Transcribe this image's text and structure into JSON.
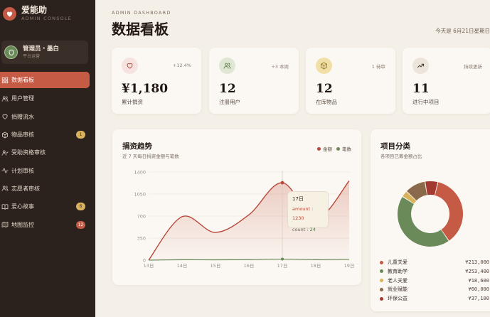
{
  "brand": {
    "name": "爱能助",
    "subtitle": "ADMIN CONSOLE"
  },
  "profile": {
    "name": "管理员・墨白",
    "role": "平台运营"
  },
  "nav": [
    {
      "label": "数据看板",
      "icon": "grid-icon",
      "active": true
    },
    {
      "label": "用户管理",
      "icon": "users-icon"
    },
    {
      "label": "捐赠流水",
      "icon": "heart-icon"
    },
    {
      "label": "物品审核",
      "icon": "box-icon",
      "badge": "1",
      "badge_color": "#d9b25c"
    },
    {
      "label": "受助资格审核",
      "icon": "user-check-icon"
    },
    {
      "label": "计划审核",
      "icon": "pulse-icon"
    },
    {
      "label": "志愿者审核",
      "icon": "users-icon"
    },
    {
      "label": "爱心故事",
      "icon": "book-icon",
      "badge": "6",
      "badge_color": "#d9b25c"
    },
    {
      "label": "地图监控",
      "icon": "map-icon",
      "badge": "12",
      "badge_color": "#c55a45"
    }
  ],
  "header": {
    "eyebrow": "ADMIN DASHBOARD",
    "title": "数据看板",
    "date": "今天是 6月21日星期日"
  },
  "stats": [
    {
      "icon": "heart-icon",
      "icon_bg": "#f6e3df",
      "icon_color": "#b8483a",
      "trend": "+12.4%",
      "value": "¥1,180",
      "label": "累计捐资"
    },
    {
      "icon": "users-icon",
      "icon_bg": "#dfe6d4",
      "icon_color": "#5b7a4a",
      "trend": "+3 本周",
      "value": "12",
      "label": "注册用户"
    },
    {
      "icon": "box-icon",
      "icon_bg": "#f1dfa8",
      "icon_color": "#9c7a2a",
      "trend": "1 待审",
      "value": "12",
      "label": "在库物品"
    },
    {
      "icon": "trend-icon",
      "icon_bg": "#ece5dc",
      "icon_color": "#3b2e27",
      "trend": "持续更新",
      "value": "11",
      "label": "进行中项目"
    }
  ],
  "trend_panel": {
    "title": "捐资趋势",
    "subtitle": "近 7 天每日捐资金额与笔数",
    "legend": [
      {
        "label": "金额",
        "color": "#b8483a"
      },
      {
        "label": "笔数",
        "color": "#6b8a5a"
      }
    ],
    "tooltip": {
      "title": "17日",
      "amount": "amount : 1230",
      "count": "count : 24"
    }
  },
  "category_panel": {
    "title": "项目分类",
    "subtitle": "各项目已筹金额占比"
  },
  "chart_data": [
    {
      "type": "line",
      "categories": [
        "13日",
        "14日",
        "15日",
        "16日",
        "17日",
        "18日",
        "19日"
      ],
      "series": [
        {
          "name": "金额",
          "values": [
            0,
            690,
            440,
            720,
            1230,
            650,
            1260
          ]
        },
        {
          "name": "笔数",
          "values": [
            0,
            10,
            8,
            12,
            24,
            11,
            20
          ]
        }
      ],
      "ylim": [
        0,
        1400
      ],
      "yticks": [
        "0",
        "350",
        "700",
        "1050",
        "1400"
      ],
      "highlight_index": 4
    },
    {
      "type": "pie",
      "labels": [
        "儿童关爱",
        "教育助学",
        "老人关爱",
        "就业赋能",
        "环保公益"
      ],
      "values": [
        213000,
        253400,
        18600,
        60000,
        37100
      ],
      "display_values": [
        "¥213,000",
        "¥253,400",
        "¥18,600",
        "¥60,000",
        "¥37,100"
      ],
      "colors": [
        "#c55a45",
        "#6b8a5a",
        "#d9b25c",
        "#8a6a4a",
        "#a23a32"
      ]
    }
  ]
}
